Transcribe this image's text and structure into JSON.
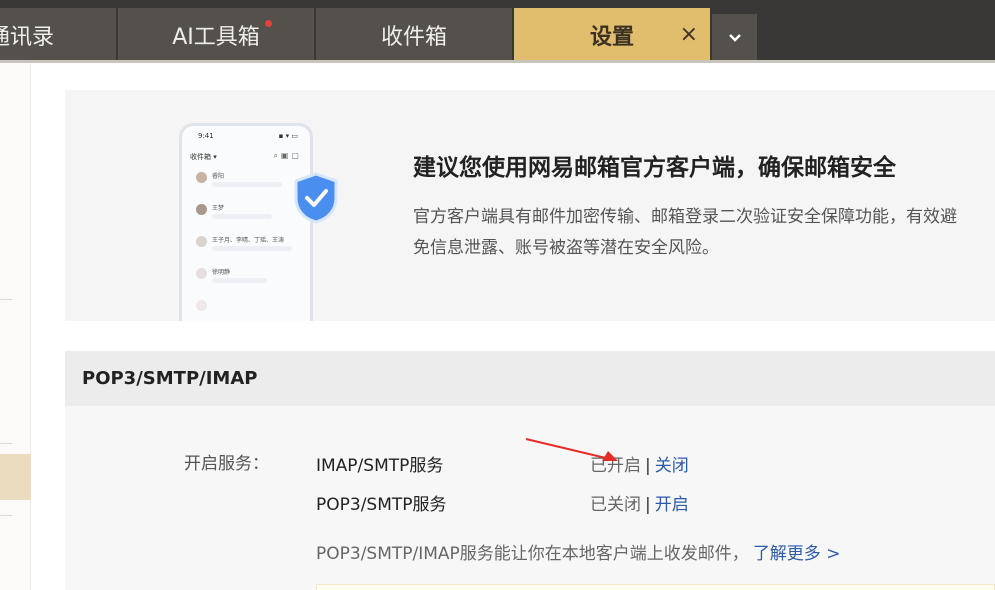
{
  "tabs": [
    {
      "label": "通讯录",
      "visible_label": "通讯录"
    },
    {
      "label": "AI工具箱",
      "has_dot": true
    },
    {
      "label": "收件箱"
    },
    {
      "label": "设置",
      "active": true,
      "close": "×"
    }
  ],
  "tab_more_icon": "chevron-down",
  "banner": {
    "title": "建议您使用网易邮箱官方客户端，确保邮箱安全",
    "description": "官方客户端具有邮件加密传输、邮箱登录二次验证安全保障功能，有效避免信息泄露、账号被盗等潜在安全风险。",
    "phone": {
      "time": "9:41",
      "header": "收件箱 ▾",
      "rows": [
        "睿阳",
        "王梦",
        "王子月、李晴、丁瑶、王涛",
        "徐明静"
      ]
    }
  },
  "pop3": {
    "section_title": "POP3/SMTP/IMAP",
    "open_service_label": "开启服务：",
    "services": [
      {
        "name": "IMAP/SMTP服务",
        "status": "已开启",
        "separator": "|",
        "action": "关闭"
      },
      {
        "name": "POP3/SMTP服务",
        "status": "已关闭",
        "separator": "|",
        "action": "开启"
      }
    ],
    "note": "POP3/SMTP/IMAP服务能让你在本地客户端上收发邮件，",
    "learn_more": "了解更多 >"
  },
  "colors": {
    "active_tab": "#e1bd6e",
    "link": "#2c5aa8",
    "arrow": "#e52d27"
  }
}
